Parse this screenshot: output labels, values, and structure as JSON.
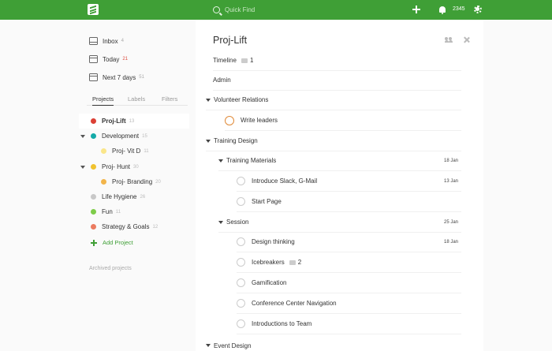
{
  "topbar": {
    "search_placeholder": "Quick Find",
    "karma_count": "2345",
    "accent_color": "#3f9f36"
  },
  "sidebar": {
    "nav": [
      {
        "label": "Inbox",
        "count": "4",
        "icon": "inbox-icon"
      },
      {
        "label": "Today",
        "count": "21",
        "icon": "calendar-icon"
      },
      {
        "label": "Next 7 days",
        "count": "51",
        "icon": "calendar-week-icon"
      }
    ],
    "tabs": [
      "Projects",
      "Labels",
      "Filters"
    ],
    "projects": [
      {
        "label": "Proj-Lift",
        "count": "13",
        "color": "#db4035"
      },
      {
        "label": "Development",
        "count": "15",
        "color": "#14aaa8"
      },
      {
        "label": "Proj- Vit D",
        "count": "11",
        "color": "#fad000"
      },
      {
        "label": "Proj- Hunt",
        "count": "30",
        "color": "#f0c22f"
      },
      {
        "label": "Proj- Branding",
        "count": "20",
        "color": "#f2b54b"
      },
      {
        "label": "Life Hygiene",
        "count": "26",
        "color": "#c8c8c8"
      },
      {
        "label": "Fun",
        "count": "11",
        "color": "#7ecc49"
      },
      {
        "label": "Strategy & Goals",
        "count": "12",
        "color": "#eb7b60"
      }
    ],
    "add_project": "Add Project",
    "archived": "Archived projects"
  },
  "main": {
    "title": "Proj-Lift",
    "items": {
      "timeline": {
        "label": "Timeline",
        "comments": "1"
      },
      "admin": {
        "label": "Admin"
      },
      "volunteer": {
        "label": "Volunteer Relations"
      },
      "write_leaders": {
        "label": "Write leaders"
      },
      "training_design": {
        "label": "Training Design"
      },
      "training_materials": {
        "label": "Training Materials",
        "date": "18 Jan"
      },
      "introduce_slack": {
        "label": "Introduce Slack, G-Mail",
        "date": "13 Jan"
      },
      "start_page": {
        "label": "Start Page"
      },
      "session": {
        "label": "Session",
        "date": "25 Jan"
      },
      "design_thinking": {
        "label": "Design thinking",
        "date": "18 Jan"
      },
      "icebreakers": {
        "label": "Icebreakers",
        "comments": "2"
      },
      "gamification": {
        "label": "Gamification"
      },
      "conference": {
        "label": "Conference Center Navigation"
      },
      "introductions": {
        "label": "Introductions to Team"
      },
      "event_design": {
        "label": "Event Design"
      }
    }
  }
}
